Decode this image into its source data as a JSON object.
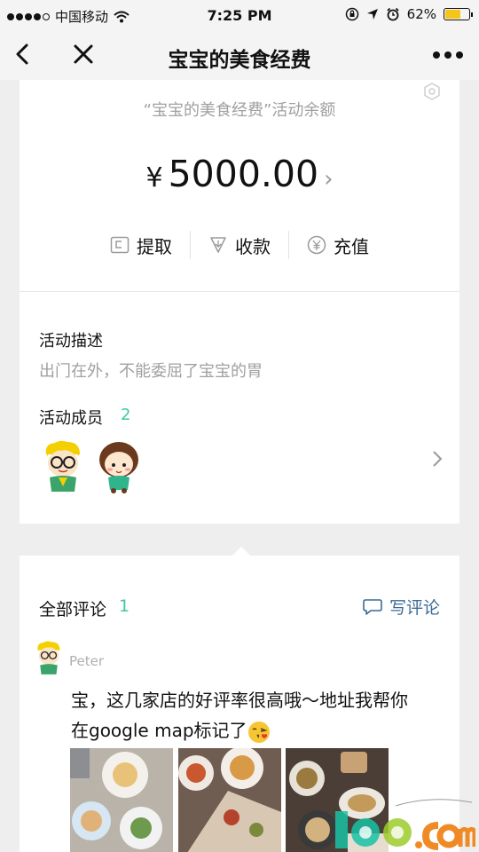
{
  "status_bar": {
    "carrier": "中国移动",
    "time": "7:25 PM",
    "battery_percent": "62%",
    "battery_level": 0.62,
    "signal_filled": 4,
    "signal_total": 5
  },
  "nav": {
    "title": "宝宝的美食经费",
    "back_icon": "chevron-left-icon",
    "close_icon": "close-icon",
    "more_icon": "more-dots-icon"
  },
  "balance": {
    "label": "“宝宝的美食经费”活动余额",
    "currency": "¥",
    "amount": "5000.00",
    "actions": [
      {
        "label": "提取",
        "icon": "wallet-icon"
      },
      {
        "label": "收款",
        "icon": "receive-icon"
      },
      {
        "label": "充值",
        "icon": "yen-coin-icon"
      }
    ]
  },
  "activity": {
    "desc_title": "活动描述",
    "desc_text": "出门在外，不能委屈了宝宝的胃",
    "members_title": "活动成员",
    "members_count": "2"
  },
  "comments": {
    "title": "全部评论",
    "count": "1",
    "write_label": "写评论",
    "items": [
      {
        "user": "Peter",
        "text_line1": "宝，这几家店的好评率很高哦～地址我帮你",
        "text_line2": "在google map标记了"
      }
    ]
  },
  "colors": {
    "accent": "#3ec7a5",
    "link": "#3a6a96",
    "muted": "#a0a0a0",
    "background": "#eeeeee"
  }
}
